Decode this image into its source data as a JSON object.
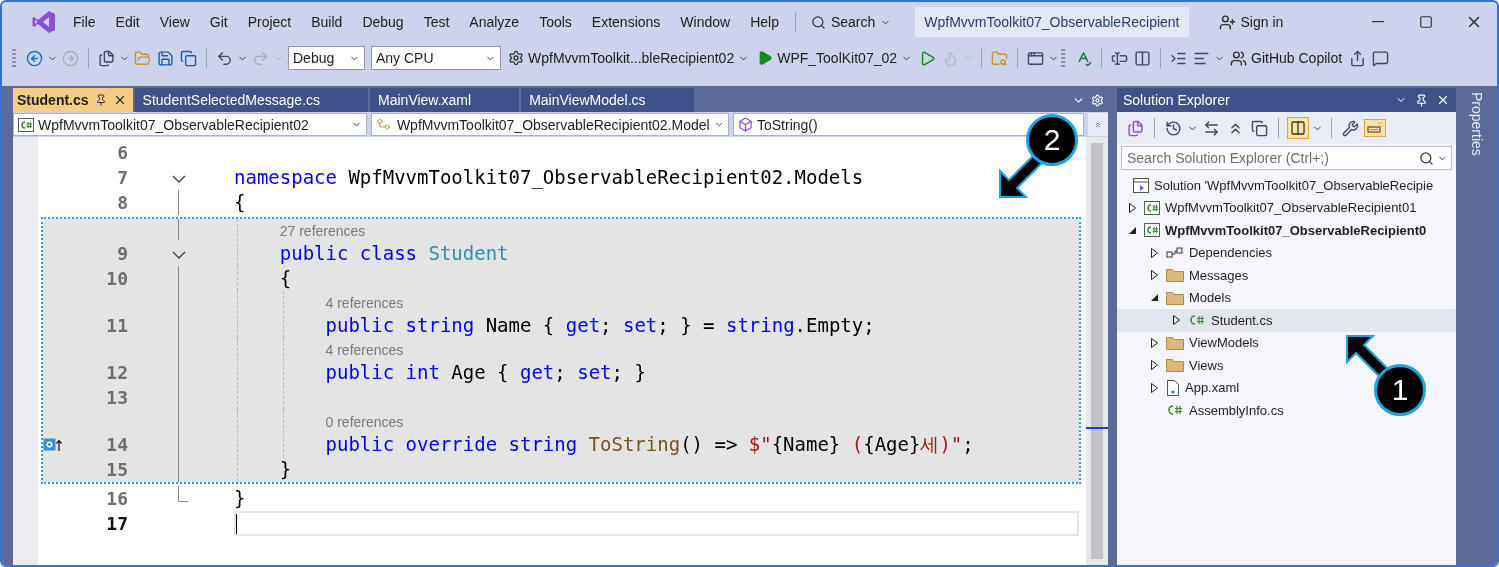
{
  "menu_bar": {
    "items": [
      "File",
      "Edit",
      "View",
      "Git",
      "Project",
      "Build",
      "Debug",
      "Test",
      "Analyze",
      "Tools",
      "Extensions",
      "Window",
      "Help"
    ],
    "search": "Search",
    "solution_title": "WpfMvvmToolkit07_ObservableRecipient",
    "sign_in": "Sign in"
  },
  "toolbar": {
    "configuration": "Debug",
    "platform": "Any CPU",
    "startup_project": "WpfMvvmToolkit...bleRecipient02",
    "run_target": "WPF_ToolKit07_02",
    "copilot": "GitHub Copilot"
  },
  "document_tabs": [
    {
      "label": "Student.cs",
      "selected": true
    },
    {
      "label": "StudentSelectedMessage.cs",
      "selected": false
    },
    {
      "label": "MainView.xaml",
      "selected": false
    },
    {
      "label": "MainViewModel.cs",
      "selected": false
    }
  ],
  "navigation_bar": {
    "project": "WpfMvvmToolkit07_ObservableRecipient02",
    "type": "WpfMvvmToolkit07_ObservableRecipient02.Model",
    "member": "ToString()"
  },
  "editor": {
    "lines": [
      {
        "number": "6",
        "highlighted": false,
        "current": false
      },
      {
        "number": "7",
        "kind": "fold-start",
        "highlighted": false,
        "current": false,
        "tokens": [
          {
            "t": "namespace ",
            "kind": "keyword"
          },
          {
            "t": "WpfMvvmToolkit07_ObservableRecipient02.Models",
            "kind": "plain"
          }
        ]
      },
      {
        "number": "8",
        "kind": "fold-body",
        "highlighted": false,
        "current": false,
        "tokens": [
          {
            "t": "{",
            "kind": "plain"
          }
        ]
      },
      {
        "number": "9",
        "kind": "fold-start",
        "highlighted": true,
        "current": false,
        "lens": "27 references",
        "tokens": [
          {
            "t": "    public class ",
            "kind": "keyword"
          },
          {
            "t": "Student",
            "kind": "type"
          }
        ]
      },
      {
        "number": "10",
        "kind": "fold-body",
        "highlighted": true,
        "current": false,
        "tokens": [
          {
            "t": "    {",
            "kind": "plain"
          }
        ]
      },
      {
        "number": "11",
        "kind": "fold-body",
        "highlighted": true,
        "current": false,
        "lens": "4 references",
        "tokens": [
          {
            "t": "        public string ",
            "kind": "keyword"
          },
          {
            "t": "Name { ",
            "kind": "plain"
          },
          {
            "t": "get",
            "kind": "keyword"
          },
          {
            "t": "; ",
            "kind": "plain"
          },
          {
            "t": "set",
            "kind": "keyword"
          },
          {
            "t": "; } = ",
            "kind": "plain"
          },
          {
            "t": "string",
            "kind": "keyword"
          },
          {
            "t": ".Empty;",
            "kind": "plain"
          }
        ]
      },
      {
        "number": "12",
        "kind": "fold-body",
        "highlighted": true,
        "current": false,
        "lens": "4 references",
        "tokens": [
          {
            "t": "        public int ",
            "kind": "keyword"
          },
          {
            "t": "Age { ",
            "kind": "plain"
          },
          {
            "t": "get",
            "kind": "keyword"
          },
          {
            "t": "; ",
            "kind": "plain"
          },
          {
            "t": "set",
            "kind": "keyword"
          },
          {
            "t": "; }",
            "kind": "plain"
          }
        ]
      },
      {
        "number": "13",
        "kind": "fold-body",
        "highlighted": true,
        "current": false
      },
      {
        "number": "14",
        "kind": "fold-body",
        "highlighted": true,
        "current": false,
        "override": true,
        "lens": "0 references",
        "tokens": [
          {
            "t": "        public override string ",
            "kind": "keyword"
          },
          {
            "t": "ToString",
            "kind": "method"
          },
          {
            "t": "() => ",
            "kind": "plain"
          },
          {
            "t": "$\"",
            "kind": "string"
          },
          {
            "t": "{Name}",
            "kind": "plain"
          },
          {
            "t": " (",
            "kind": "string"
          },
          {
            "t": "{Age}",
            "kind": "plain"
          },
          {
            "t": "세)\"",
            "kind": "string"
          },
          {
            "t": ";",
            "kind": "plain"
          }
        ]
      },
      {
        "number": "15",
        "kind": "fold-body",
        "highlighted": true,
        "current": false,
        "tokens": [
          {
            "t": "    }",
            "kind": "plain"
          }
        ]
      },
      {
        "number": "16",
        "kind": "fold-end",
        "highlighted": false,
        "current": false,
        "tokens": [
          {
            "t": "}",
            "kind": "plain"
          }
        ]
      },
      {
        "number": "17",
        "highlighted": false,
        "current": true
      }
    ]
  },
  "solution_explorer": {
    "title": "Solution Explorer",
    "search": {
      "placeholder": "Search Solution Explorer (Ctrl+;)"
    },
    "solution": "Solution 'WpfMvvmToolkit07_ObservableRecipie",
    "tree": [
      {
        "label": "WpfMvvmToolkit07_ObservableRecipient01",
        "kind": "project",
        "bold": false,
        "selected": false,
        "expanded": false
      },
      {
        "label": "WpfMvvmToolkit07_ObservableRecipient0",
        "kind": "project",
        "bold": true,
        "selected": false,
        "expanded": true,
        "children": [
          {
            "label": "Dependencies",
            "kind": "dependencies",
            "bold": false,
            "selected": false,
            "expanded": false
          },
          {
            "label": "Messages",
            "kind": "folder",
            "bold": false,
            "selected": false,
            "expanded": false
          },
          {
            "label": "Models",
            "kind": "folder",
            "bold": false,
            "selected": false,
            "expanded": true,
            "children": [
              {
                "label": "Student.cs",
                "kind": "csharp",
                "bold": false,
                "selected": true,
                "expanded": false
              }
            ]
          },
          {
            "label": "ViewModels",
            "kind": "folder",
            "bold": false,
            "selected": false,
            "expanded": false
          },
          {
            "label": "Views",
            "kind": "folder",
            "bold": false,
            "selected": false,
            "expanded": false
          },
          {
            "label": "App.xaml",
            "kind": "xaml",
            "bold": false,
            "selected": false,
            "expanded": false
          },
          {
            "label": "AssemblyInfo.cs",
            "kind": "csharp",
            "bold": false,
            "selected": false
          }
        ]
      }
    ]
  },
  "properties_tab": "Properties",
  "callouts": [
    {
      "label": "2",
      "kind": "code"
    },
    {
      "label": "1",
      "kind": "tree"
    }
  ]
}
